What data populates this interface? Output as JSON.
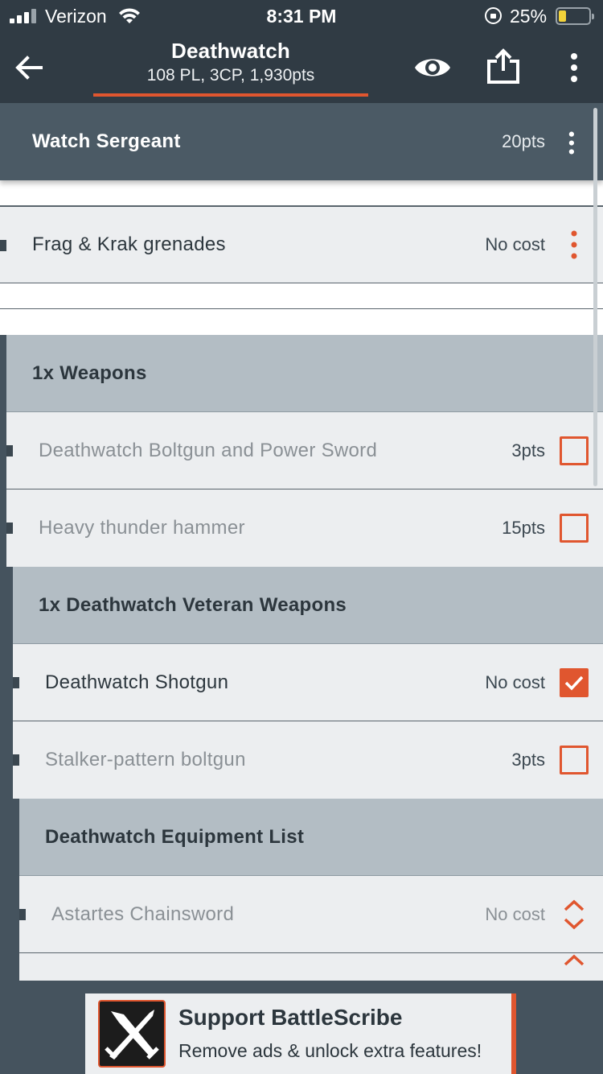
{
  "status_bar": {
    "carrier": "Verizon",
    "time": "8:31 PM",
    "battery_percent": "25%"
  },
  "toolbar": {
    "title": "Deathwatch",
    "subtitle": "108 PL, 3CP, 1,930pts",
    "icons": [
      "back-arrow-icon",
      "eye-icon",
      "share-icon",
      "more-vertical-icon"
    ]
  },
  "unit": {
    "name": "Watch Sergeant",
    "cost": "20pts"
  },
  "grenades": {
    "label": "Frag & Krak grenades",
    "cost": "No cost"
  },
  "groups": [
    {
      "title": "1x Weapons",
      "items": [
        {
          "label": "Deathwatch Boltgun and Power Sword",
          "cost": "3pts",
          "checked": false
        },
        {
          "label": "Heavy thunder hammer",
          "cost": "15pts",
          "checked": false
        }
      ]
    },
    {
      "title": "1x Deathwatch Veteran Weapons",
      "items": [
        {
          "label": "Deathwatch Shotgun",
          "cost": "No cost",
          "checked": true
        },
        {
          "label": "Stalker-pattern boltgun",
          "cost": "3pts",
          "checked": false
        }
      ]
    },
    {
      "title": "Deathwatch Equipment List",
      "items": [
        {
          "label": "Astartes Chainsword",
          "cost": "No cost",
          "control": "stepper"
        }
      ]
    }
  ],
  "ad": {
    "title": "Support BattleScribe",
    "subtitle": "Remove ads & unlock extra features!"
  },
  "colors": {
    "accent": "#e0562f",
    "toolbar": "#303b44",
    "unit_row": "#4b5a65",
    "group_row": "#b3bdc4",
    "item_row": "#eceef0"
  }
}
